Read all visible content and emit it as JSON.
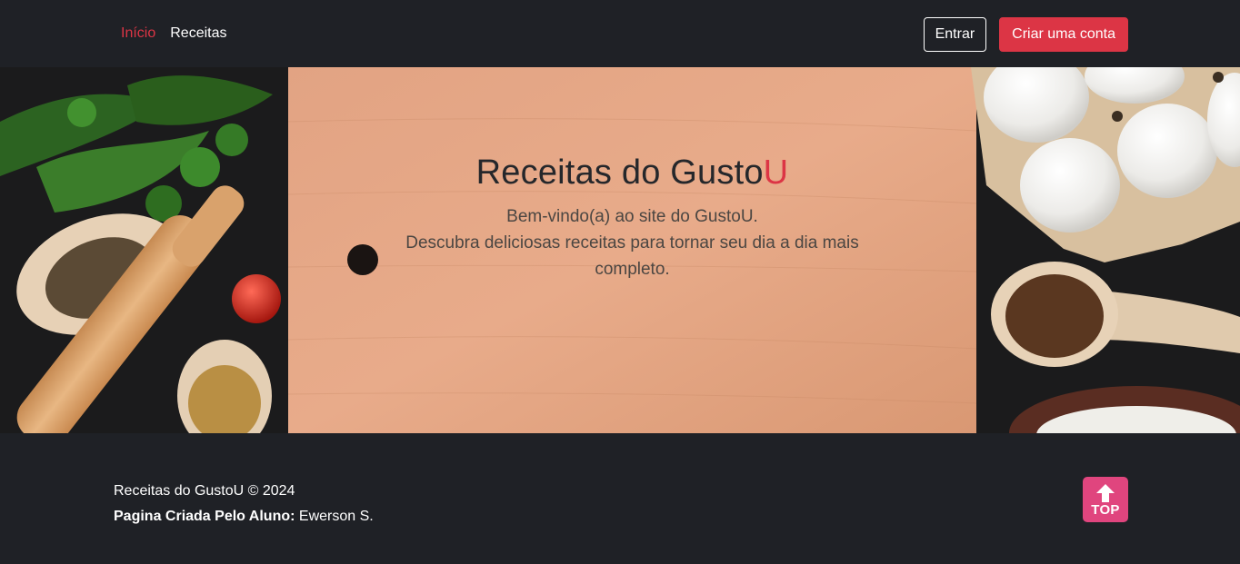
{
  "nav": {
    "links": [
      {
        "label": "Início",
        "active": true
      },
      {
        "label": "Receitas",
        "active": false
      }
    ],
    "login_label": "Entrar",
    "signup_label": "Criar uma conta"
  },
  "hero": {
    "title_main": "Receitas do Gusto",
    "title_accent": "U",
    "line1": "Bem-vindo(a) ao site do GustoU.",
    "line2": "Descubra deliciosas receitas para tornar seu dia a dia mais completo."
  },
  "footer": {
    "copyright": "Receitas do GustoU © 2024",
    "author_label": "Pagina Criada Pelo Aluno:",
    "author_name": "Ewerson S.",
    "top_label": "TOP"
  },
  "colors": {
    "background": "#1f2126",
    "accent": "#dc3545",
    "top_button": "#e0457e"
  }
}
